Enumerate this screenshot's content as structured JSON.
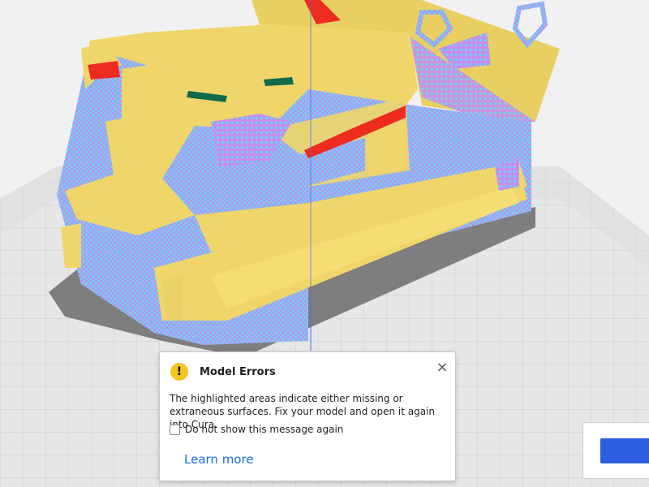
{
  "dialog": {
    "title": "Model Errors",
    "icon": "warning-icon",
    "icon_glyph": "!",
    "close_glyph": "×",
    "message": "The highlighted areas indicate either missing or extraneous surfaces. Fix your model and open it again into Cura.",
    "checkbox_label": "Do not show this message again",
    "checkbox_checked": false,
    "link_label": "Learn more"
  },
  "colors": {
    "model_yellow": "#f0d66a",
    "error_magenta": "#c98cf0",
    "error_cyan": "#62d6f0",
    "error_red": "#ee2b1f",
    "build_plate": "#ebebeb",
    "warning": "#f3c61f",
    "link": "#196ef0",
    "accent_button": "#2e5fe3"
  }
}
